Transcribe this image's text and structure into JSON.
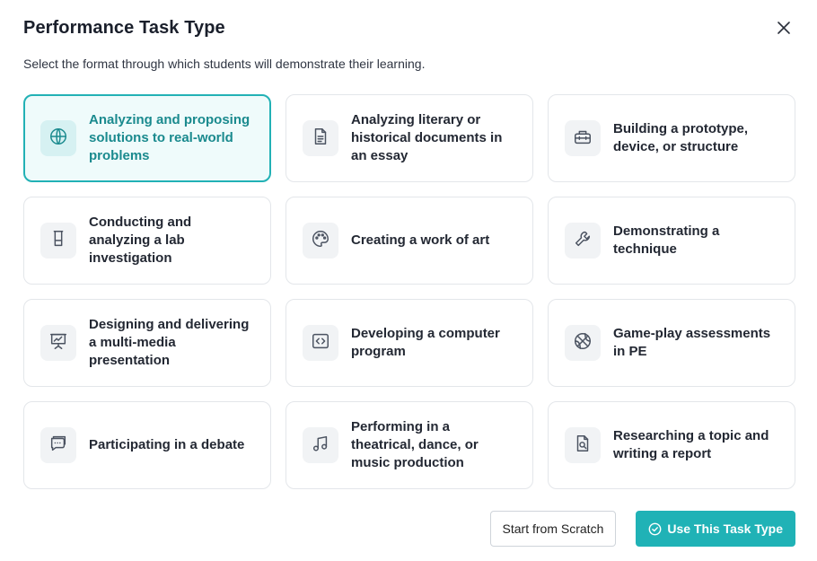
{
  "dialog": {
    "title": "Performance Task Type",
    "subtitle": "Select the format through which students will demonstrate their learning."
  },
  "options": [
    {
      "label": "Analyzing and proposing solutions to real-world problems",
      "icon": "globe-icon",
      "selected": true
    },
    {
      "label": "Analyzing literary or historical documents in an essay",
      "icon": "document-icon",
      "selected": false
    },
    {
      "label": "Building a prototype, device, or structure",
      "icon": "toolbox-icon",
      "selected": false
    },
    {
      "label": "Conducting and analyzing a lab investigation",
      "icon": "beaker-icon",
      "selected": false
    },
    {
      "label": "Creating a work of art",
      "icon": "palette-icon",
      "selected": false
    },
    {
      "label": "Demonstrating a technique",
      "icon": "wrench-icon",
      "selected": false
    },
    {
      "label": "Designing and delivering a multi-media presentation",
      "icon": "presentation-icon",
      "selected": false
    },
    {
      "label": "Developing a computer program",
      "icon": "code-icon",
      "selected": false
    },
    {
      "label": "Game-play assessments in PE",
      "icon": "basketball-icon",
      "selected": false
    },
    {
      "label": "Participating in a debate",
      "icon": "chat-bubbles-icon",
      "selected": false
    },
    {
      "label": "Performing in a theatrical, dance, or music production",
      "icon": "music-note-icon",
      "selected": false
    },
    {
      "label": "Researching a topic and writing a report",
      "icon": "file-search-icon",
      "selected": false
    }
  ],
  "footer": {
    "scratch_label": "Start from Scratch",
    "use_label": "Use This Task Type"
  },
  "colors": {
    "accent": "#20b2b6",
    "selected_bg": "#effbfb",
    "selected_text": "#1a8a8e"
  }
}
